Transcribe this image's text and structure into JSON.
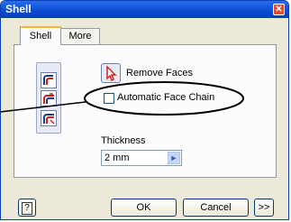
{
  "window": {
    "title": "Shell",
    "close_glyph": "✕"
  },
  "tabs": [
    {
      "label": "Shell",
      "active": true
    },
    {
      "label": "More",
      "active": false
    }
  ],
  "shell": {
    "remove_faces_label": "Remove Faces",
    "automatic_face_chain_label": "Automatic Face Chain",
    "automatic_face_chain_checked": false,
    "thickness_label": "Thickness",
    "thickness_value": "2 mm"
  },
  "buttons": {
    "help": "?",
    "ok": "OK",
    "cancel": "Cancel",
    "more": ">>"
  },
  "icons": {
    "direction_buttons": [
      "inside-direction-icon",
      "outside-direction-icon",
      "both-direction-icon"
    ],
    "remove_faces": "select-arrow-icon",
    "combo": "chevron-right-icon"
  },
  "colors": {
    "title_bar": "#0a4ad0",
    "active_tab_accent": "#f7b638",
    "annotation": "#000000"
  }
}
